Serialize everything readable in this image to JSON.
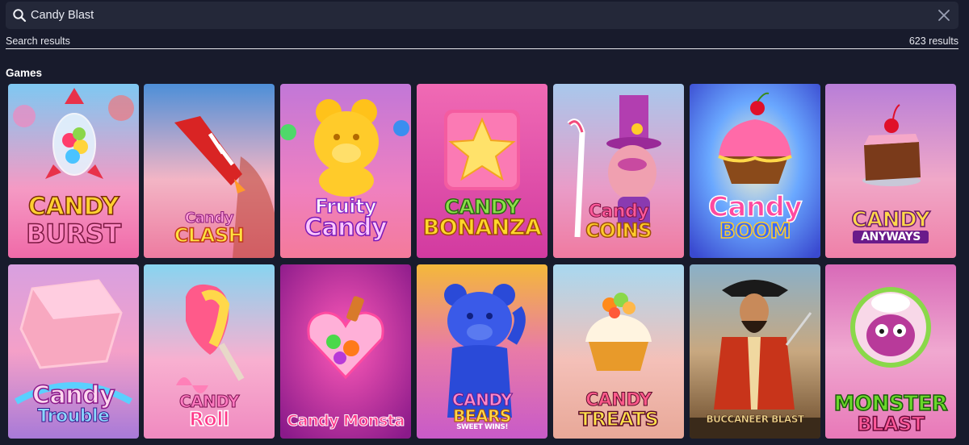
{
  "search": {
    "value": "Candy Blast",
    "placeholder": ""
  },
  "results": {
    "label": "Search results",
    "count": "623 results"
  },
  "section": {
    "title": "Games"
  },
  "games": [
    {
      "line1": "CANDY",
      "line2": "BURST"
    },
    {
      "line1": "Candy",
      "line2": "CLASH"
    },
    {
      "line1": "Fruity",
      "line2": "Candy"
    },
    {
      "line1": "CANDY",
      "line2": "BONANZA"
    },
    {
      "line1": "Candy",
      "line2": "COINS"
    },
    {
      "line1": "Candy",
      "line2": "BOOM"
    },
    {
      "line1": "CANDY",
      "line2": "ANYWAYS"
    },
    {
      "line1": "Candy",
      "line2": "Trouble"
    },
    {
      "line1": "CANDY",
      "line2": "Roll"
    },
    {
      "line1": "Candy Monsta",
      "line2": ""
    },
    {
      "line1": "CANDY",
      "line2": "BEARS",
      "line3": "SWEET WINS!"
    },
    {
      "line1": "CANDY",
      "line2": "TREATS"
    },
    {
      "line1": "BUCCANEER BLAST",
      "line2": ""
    },
    {
      "line1": "MONSTER",
      "line2": "BLAST"
    }
  ],
  "colors": {
    "background": "#181b2c",
    "search_bg": "#242839",
    "text": "#e6e7ee"
  }
}
